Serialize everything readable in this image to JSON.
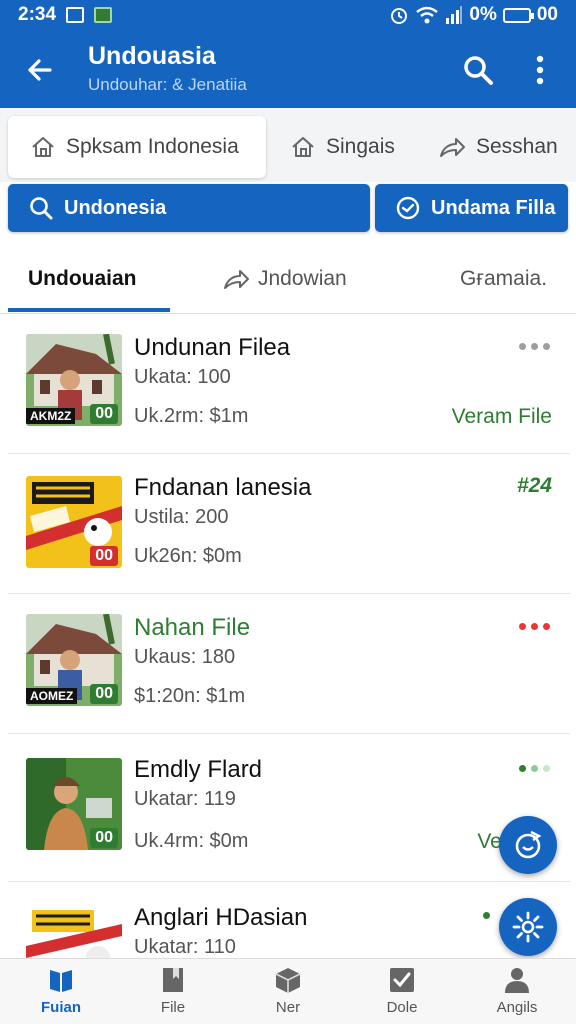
{
  "status_bar": {
    "time": "2:34",
    "battery": "0%",
    "clock_right": "00"
  },
  "app_bar": {
    "title": "Undouasia",
    "subtitle": "Undouhar: & Jenatiia"
  },
  "chips": [
    {
      "label": "Spksam Indonesia",
      "icon": "home-icon"
    },
    {
      "label": "Singais",
      "icon": "home-icon"
    },
    {
      "label": "Sesshan",
      "icon": "share-icon"
    }
  ],
  "filters": [
    {
      "label": "Undonesia",
      "icon": "search-icon"
    },
    {
      "label": "Undama Filla",
      "icon": "circle-check-icon"
    }
  ],
  "tabs": [
    {
      "label": "Undouaian"
    },
    {
      "label": "Jndowian",
      "icon": "share-icon"
    },
    {
      "label": "Gғamaia."
    }
  ],
  "items": [
    {
      "title": "Undunan Filea",
      "line1": "Ukata: 100",
      "line2": "Uk.2rm: $1m",
      "action": "Veram File",
      "badge": "00",
      "thumb_label": "AKM2Z",
      "menu": "dots"
    },
    {
      "title": "Fndanan lanesia",
      "line1": "Ustila: 200",
      "line2": "Uk26n: $0m",
      "action": "#24",
      "badge": "00",
      "thumb_label": "",
      "menu": ""
    },
    {
      "title": "Nahan File",
      "line1": "Ukaus: 180",
      "line2": "$1:20n: $1m",
      "action": "",
      "badge": "00",
      "thumb_label": "AOMEZ",
      "menu": "dots-red"
    },
    {
      "title": "Emdly Flard",
      "line1": "Ukatar: 119",
      "line2": "Uk.4rm: $0m",
      "action": "Versi",
      "badge": "00",
      "thumb_label": "",
      "menu": "dots-green"
    },
    {
      "title": "Anglari HDasian",
      "line1": "Ukatar: 110",
      "line2": "",
      "action": "",
      "badge": "",
      "thumb_label": "",
      "menu": "dot"
    }
  ],
  "bottom_nav": [
    {
      "label": "Fuian",
      "icon": "book-icon"
    },
    {
      "label": "File",
      "icon": "file-icon"
    },
    {
      "label": "Ner",
      "icon": "box-icon"
    },
    {
      "label": "Dole",
      "icon": "checkbox-icon"
    },
    {
      "label": "Angils",
      "icon": "person-icon"
    }
  ],
  "colors": {
    "primary": "#1565c0",
    "green": "#2e7d32",
    "red": "#e53935"
  }
}
